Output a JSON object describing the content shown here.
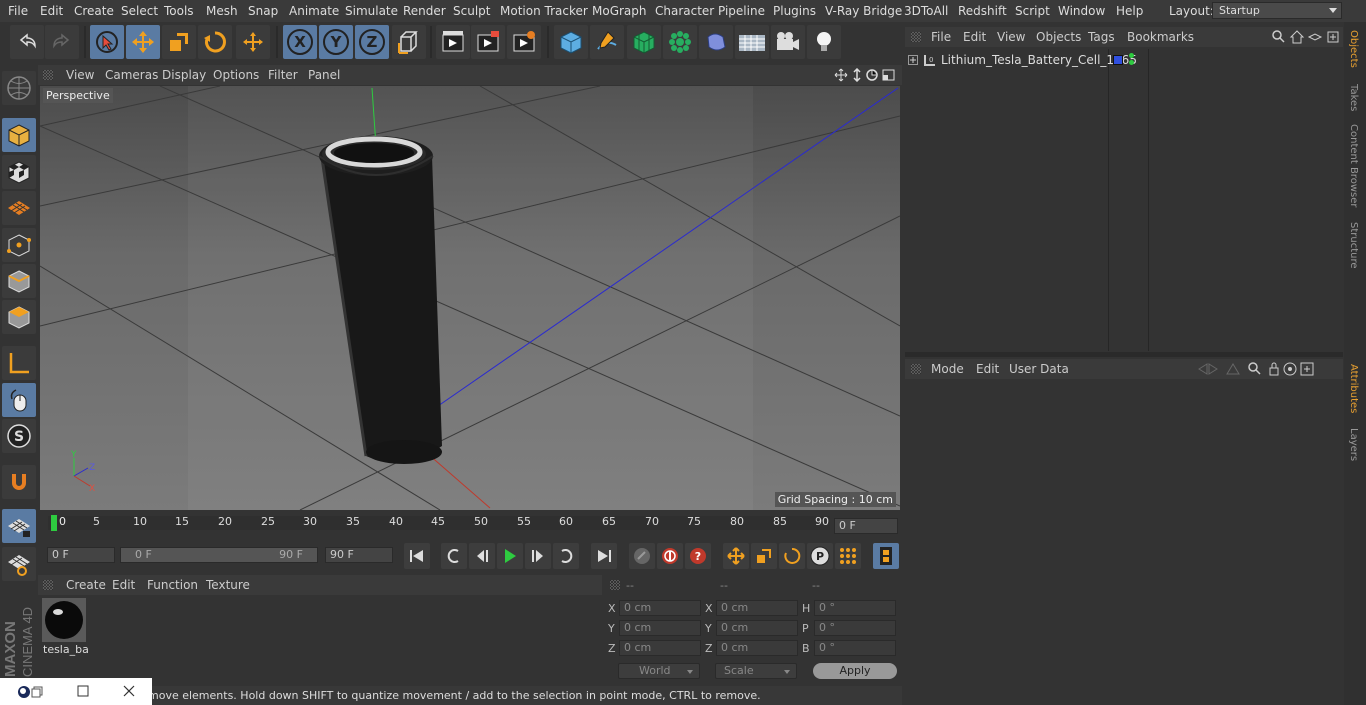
{
  "menubar": {
    "items": [
      "File",
      "Edit",
      "Create",
      "Select",
      "Tools",
      "Mesh",
      "Snap",
      "Animate",
      "Simulate",
      "Render",
      "Sculpt",
      "Motion Tracker",
      "MoGraph",
      "Character",
      "Pipeline",
      "Plugins",
      "V-Ray Bridge",
      "3DToAll",
      "Redshift",
      "Script",
      "Window",
      "Help"
    ],
    "layout_label": "Layout:",
    "layout_value": "Startup"
  },
  "toolbar": {
    "icons": [
      "undo-icon",
      "redo-icon",
      "live-selection-icon",
      "move-icon",
      "scale-icon",
      "rotate-icon",
      "transform-icon",
      "x-axis-icon",
      "y-axis-icon",
      "z-axis-icon",
      "world-coordinates-icon",
      "render-view-icon",
      "render-picture-viewer-icon",
      "render-settings-icon",
      "cube-icon",
      "pen-icon",
      "subdivision-icon",
      "cloner-icon",
      "deformer-icon",
      "floor-icon",
      "camera-icon",
      "light-icon"
    ],
    "axis_x": "X",
    "axis_y": "Y",
    "axis_z": "Z"
  },
  "viewport": {
    "menu": [
      "View",
      "Cameras",
      "Display",
      "Options",
      "Filter",
      "Panel"
    ],
    "label": "Perspective",
    "grid_spacing": "Grid Spacing : 10 cm",
    "axis_y": "Y",
    "axis_z": "Z",
    "axis_x": "X"
  },
  "timeline": {
    "ticks": [
      "0",
      "5",
      "10",
      "15",
      "20",
      "25",
      "30",
      "35",
      "40",
      "45",
      "50",
      "55",
      "60",
      "65",
      "70",
      "75",
      "80",
      "85",
      "90"
    ],
    "current_frame": "0 F",
    "start_frame": "0 F",
    "range_start": "0 F",
    "range_end": "90 F",
    "end_frame": "90 F"
  },
  "material_manager": {
    "menu": [
      "Create",
      "Edit",
      "Function",
      "Texture"
    ],
    "material_name": "tesla_ba"
  },
  "coordinates": {
    "headers": [
      "--",
      "--",
      "--"
    ],
    "pos_labels": [
      "X",
      "Y",
      "Z"
    ],
    "pos_values": [
      "0 cm",
      "0 cm",
      "0 cm"
    ],
    "size_labels": [
      "X",
      "Y",
      "Z"
    ],
    "size_values": [
      "0 cm",
      "0 cm",
      "0 cm"
    ],
    "rot_labels": [
      "H",
      "P",
      "B"
    ],
    "rot_values": [
      "0 °",
      "0 °",
      "0 °"
    ],
    "mode_world": "World",
    "mode_scale": "Scale",
    "apply": "Apply"
  },
  "status": {
    "text": "move elements. Hold down SHIFT to quantize movement / add to the selection in point mode, CTRL to remove."
  },
  "object_manager": {
    "menu": [
      "File",
      "Edit",
      "View",
      "Objects",
      "Tags",
      "Bookmarks"
    ],
    "objects": [
      {
        "name": "Lithium_Tesla_Battery_Cell_1865"
      }
    ]
  },
  "attributes": {
    "menu": [
      "Mode",
      "Edit",
      "User Data"
    ]
  },
  "side_tabs": {
    "top": [
      "Objects",
      "Takes",
      "Content Browser",
      "Structure"
    ],
    "bottom": [
      "Attributes",
      "Layers"
    ]
  },
  "branding": {
    "maxon": "MAXON",
    "product": "CINEMA 4D"
  },
  "colors": {
    "accent_blue": "#5a7ba3",
    "active_tab": "#e8a030",
    "axis_red": "#c0392b",
    "axis_green": "#2ecc40",
    "axis_blue": "#2a2ad0"
  }
}
